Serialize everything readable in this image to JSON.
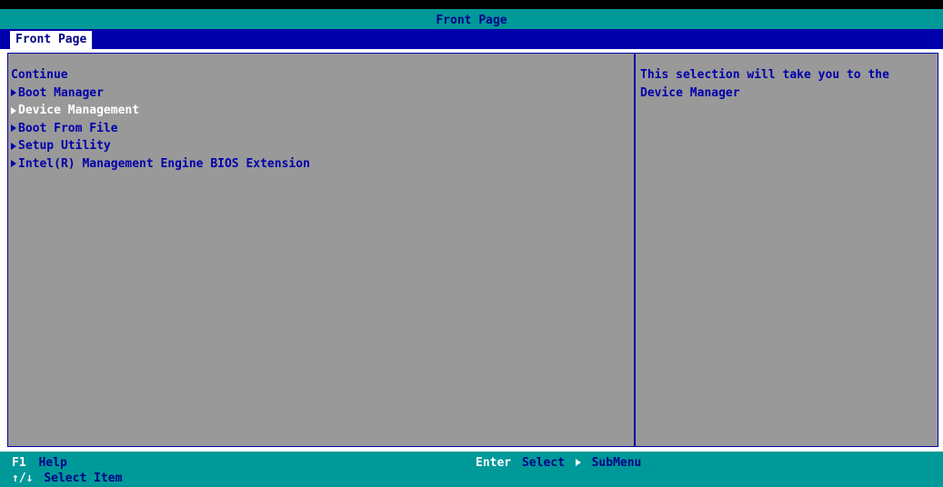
{
  "window": {
    "title": "Front Page"
  },
  "tabs": [
    {
      "label": "Front Page",
      "active": true
    }
  ],
  "menu": {
    "items": [
      {
        "label": "Continue",
        "has_submenu": false,
        "selected": false
      },
      {
        "label": "Boot Manager",
        "has_submenu": true,
        "selected": false
      },
      {
        "label": "Device Management",
        "has_submenu": true,
        "selected": true
      },
      {
        "label": "Boot From File",
        "has_submenu": true,
        "selected": false
      },
      {
        "label": "Setup Utility",
        "has_submenu": true,
        "selected": false
      },
      {
        "label": "Intel(R) Management Engine BIOS Extension",
        "has_submenu": true,
        "selected": false
      }
    ]
  },
  "help": {
    "text": "This selection will take you to the\nDevice Manager"
  },
  "footer": {
    "f1_key": "F1",
    "f1_desc": "Help",
    "updown_key": "↑/↓",
    "updown_desc": "Select Item",
    "enter_key": "Enter",
    "enter_desc": "Select",
    "submenu_desc": "SubMenu"
  },
  "colors": {
    "title_bar": "#009999",
    "tab_bar": "#0000aa",
    "panel_bg": "#999999",
    "text": "#0000aa",
    "highlight_text": "#ffffff"
  },
  "icons": {
    "submenu_arrow": "right-triangle-icon"
  }
}
